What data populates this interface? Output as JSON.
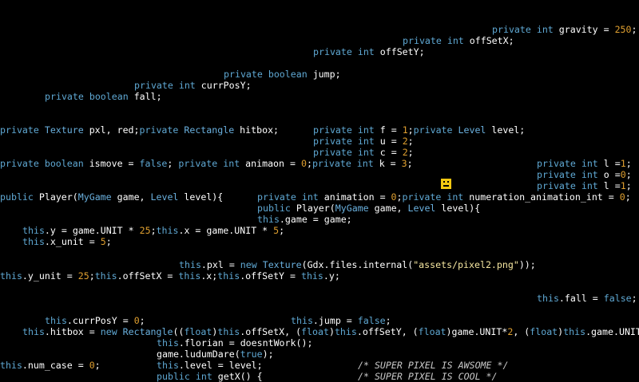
{
  "theme": {
    "background": "#000000",
    "default_text": "#ffffff",
    "keyword": "#5fa8d3",
    "number": "#e0a030",
    "string": "#f5e6a0",
    "comment": "#c8c8c8"
  },
  "lines": [
    {
      "tokens": [
        {
          "t": "private int ",
          "c": "kw"
        },
        {
          "t": "gravity = ",
          "c": "w"
        },
        {
          "t": "250",
          "c": "num"
        },
        {
          "t": ";",
          "c": "w"
        }
      ]
    },
    {
      "tokens": [
        {
          "t": "private int ",
          "c": "kw"
        },
        {
          "t": "offSetX;",
          "c": "w"
        }
      ]
    },
    {
      "tokens": [
        {
          "t": "private int ",
          "c": "kw"
        },
        {
          "t": "offSetY;",
          "c": "w"
        }
      ]
    },
    {
      "tokens": [
        {
          "t": "private boolean ",
          "c": "kw"
        },
        {
          "t": "jump;",
          "c": "w"
        }
      ]
    },
    {
      "tokens": [
        {
          "t": "private int ",
          "c": "kw"
        },
        {
          "t": "currPosY;",
          "c": "w"
        }
      ]
    },
    {
      "tokens": [
        {
          "t": "private boolean ",
          "c": "kw"
        },
        {
          "t": "fall;",
          "c": "w"
        }
      ]
    },
    {
      "tokens": [
        {
          "t": "private ",
          "c": "kw"
        },
        {
          "t": "Texture ",
          "c": "ty"
        },
        {
          "t": "pxl, red;",
          "c": "w"
        },
        {
          "t": "private ",
          "c": "kw"
        },
        {
          "t": "Rectangle ",
          "c": "ty"
        },
        {
          "t": "hitbox;",
          "c": "w"
        }
      ]
    },
    {
      "tokens": [
        {
          "t": "private int ",
          "c": "kw"
        },
        {
          "t": "f = ",
          "c": "w"
        },
        {
          "t": "1",
          "c": "num"
        },
        {
          "t": ";",
          "c": "w"
        },
        {
          "t": "private ",
          "c": "kw"
        },
        {
          "t": "Level ",
          "c": "ty"
        },
        {
          "t": "level;",
          "c": "w"
        }
      ]
    },
    {
      "tokens": [
        {
          "t": "private int ",
          "c": "kw"
        },
        {
          "t": "u = ",
          "c": "w"
        },
        {
          "t": "2",
          "c": "num"
        },
        {
          "t": ";",
          "c": "w"
        }
      ]
    },
    {
      "tokens": [
        {
          "t": "private int ",
          "c": "kw"
        },
        {
          "t": "c = ",
          "c": "w"
        },
        {
          "t": "2",
          "c": "num"
        },
        {
          "t": ";",
          "c": "w"
        }
      ]
    },
    {
      "tokens": [
        {
          "t": "private boolean ",
          "c": "kw"
        },
        {
          "t": "ismove = ",
          "c": "w"
        },
        {
          "t": "false",
          "c": "kw"
        },
        {
          "t": "; ",
          "c": "w"
        },
        {
          "t": "private int ",
          "c": "kw"
        },
        {
          "t": "animaon = ",
          "c": "w"
        },
        {
          "t": "0",
          "c": "num"
        },
        {
          "t": ";",
          "c": "w"
        },
        {
          "t": "private int ",
          "c": "kw"
        },
        {
          "t": "k = ",
          "c": "w"
        },
        {
          "t": "3",
          "c": "num"
        },
        {
          "t": ";",
          "c": "w"
        }
      ]
    },
    {
      "tokens": [
        {
          "t": "private int ",
          "c": "kw"
        },
        {
          "t": "l =",
          "c": "w"
        },
        {
          "t": "1",
          "c": "num"
        },
        {
          "t": ";",
          "c": "w"
        }
      ]
    },
    {
      "tokens": [
        {
          "t": "private int ",
          "c": "kw"
        },
        {
          "t": "o =",
          "c": "w"
        },
        {
          "t": "0",
          "c": "num"
        },
        {
          "t": ";",
          "c": "w"
        }
      ]
    },
    {
      "tokens": [
        {
          "t": "private int ",
          "c": "kw"
        },
        {
          "t": "l =",
          "c": "w"
        },
        {
          "t": "1",
          "c": "num"
        },
        {
          "t": ";",
          "c": "w"
        }
      ]
    },
    {
      "tokens": [
        {
          "t": "public ",
          "c": "kw"
        },
        {
          "t": "Player(",
          "c": "w"
        },
        {
          "t": "MyGame ",
          "c": "ty"
        },
        {
          "t": "game, ",
          "c": "w"
        },
        {
          "t": "Level ",
          "c": "ty"
        },
        {
          "t": "level){",
          "c": "w"
        }
      ]
    },
    {
      "tokens": [
        {
          "t": "private int ",
          "c": "kw"
        },
        {
          "t": "animation = ",
          "c": "w"
        },
        {
          "t": "0",
          "c": "num"
        },
        {
          "t": ";",
          "c": "w"
        },
        {
          "t": "private int ",
          "c": "kw"
        },
        {
          "t": "numeration_animation_int = ",
          "c": "w"
        },
        {
          "t": "0",
          "c": "num"
        },
        {
          "t": ";",
          "c": "w"
        }
      ]
    },
    {
      "tokens": [
        {
          "t": "public ",
          "c": "kw"
        },
        {
          "t": "Player(",
          "c": "w"
        },
        {
          "t": "MyGame ",
          "c": "ty"
        },
        {
          "t": "game, ",
          "c": "w"
        },
        {
          "t": "Level ",
          "c": "ty"
        },
        {
          "t": "level){",
          "c": "w"
        }
      ]
    },
    {
      "tokens": [
        {
          "t": "this",
          "c": "kw"
        },
        {
          "t": ".game = game;",
          "c": "w"
        }
      ]
    },
    {
      "tokens": [
        {
          "t": "this",
          "c": "kw"
        },
        {
          "t": ".y = game.UNIT * ",
          "c": "w"
        },
        {
          "t": "25",
          "c": "num"
        },
        {
          "t": ";",
          "c": "w"
        },
        {
          "t": "this",
          "c": "kw"
        },
        {
          "t": ".x = game.UNIT * ",
          "c": "w"
        },
        {
          "t": "5",
          "c": "num"
        },
        {
          "t": ";",
          "c": "w"
        }
      ]
    },
    {
      "tokens": [
        {
          "t": "this",
          "c": "kw"
        },
        {
          "t": ".x_unit = ",
          "c": "w"
        },
        {
          "t": "5",
          "c": "num"
        },
        {
          "t": ";",
          "c": "w"
        }
      ]
    },
    {
      "tokens": [
        {
          "t": "this",
          "c": "kw"
        },
        {
          "t": ".pxl = ",
          "c": "w"
        },
        {
          "t": "new ",
          "c": "kw"
        },
        {
          "t": "Texture",
          "c": "ty"
        },
        {
          "t": "(Gdx.files.internal(",
          "c": "w"
        },
        {
          "t": "\"assets/pixel2.png\"",
          "c": "str"
        },
        {
          "t": "));",
          "c": "w"
        }
      ]
    },
    {
      "tokens": [
        {
          "t": "this",
          "c": "kw"
        },
        {
          "t": ".y_unit = ",
          "c": "w"
        },
        {
          "t": "25",
          "c": "num"
        },
        {
          "t": ";",
          "c": "w"
        },
        {
          "t": "this",
          "c": "kw"
        },
        {
          "t": ".offSetX = ",
          "c": "w"
        },
        {
          "t": "this",
          "c": "kw"
        },
        {
          "t": ".x;",
          "c": "w"
        },
        {
          "t": "this",
          "c": "kw"
        },
        {
          "t": ".offSetY = ",
          "c": "w"
        },
        {
          "t": "this",
          "c": "kw"
        },
        {
          "t": ".y;",
          "c": "w"
        }
      ]
    },
    {
      "tokens": [
        {
          "t": "this",
          "c": "kw"
        },
        {
          "t": ".fall = ",
          "c": "w"
        },
        {
          "t": "false",
          "c": "kw"
        },
        {
          "t": ";",
          "c": "w"
        }
      ]
    },
    {
      "tokens": [
        {
          "t": "this",
          "c": "kw"
        },
        {
          "t": ".currPosY = ",
          "c": "w"
        },
        {
          "t": "0",
          "c": "num"
        },
        {
          "t": ";",
          "c": "w"
        }
      ]
    },
    {
      "tokens": [
        {
          "t": "this",
          "c": "kw"
        },
        {
          "t": ".jump = ",
          "c": "w"
        },
        {
          "t": "false",
          "c": "kw"
        },
        {
          "t": ";",
          "c": "w"
        }
      ]
    },
    {
      "tokens": [
        {
          "t": "this",
          "c": "kw"
        },
        {
          "t": ".hitbox = ",
          "c": "w"
        },
        {
          "t": "new ",
          "c": "kw"
        },
        {
          "t": "Rectangle",
          "c": "ty"
        },
        {
          "t": "((",
          "c": "w"
        },
        {
          "t": "float",
          "c": "kw"
        },
        {
          "t": ")",
          "c": "w"
        },
        {
          "t": "this",
          "c": "kw"
        },
        {
          "t": ".offSetX, (",
          "c": "w"
        },
        {
          "t": "float",
          "c": "kw"
        },
        {
          "t": ")",
          "c": "w"
        },
        {
          "t": "this",
          "c": "kw"
        },
        {
          "t": ".offSetY, (",
          "c": "w"
        },
        {
          "t": "float",
          "c": "kw"
        },
        {
          "t": ")game.UNIT*",
          "c": "w"
        },
        {
          "t": "2",
          "c": "num"
        },
        {
          "t": ", (",
          "c": "w"
        },
        {
          "t": "float",
          "c": "kw"
        },
        {
          "t": ")",
          "c": "w"
        },
        {
          "t": "this",
          "c": "kw"
        },
        {
          "t": ".game.UNIT",
          "c": "w"
        }
      ]
    },
    {
      "tokens": [
        {
          "t": "this",
          "c": "kw"
        },
        {
          "t": ".florian = doesntWork();",
          "c": "w"
        }
      ]
    },
    {
      "tokens": [
        {
          "t": "game.ludumDare(",
          "c": "w"
        },
        {
          "t": "true",
          "c": "kw"
        },
        {
          "t": ");",
          "c": "w"
        }
      ]
    },
    {
      "tokens": [
        {
          "t": "this",
          "c": "kw"
        },
        {
          "t": ".num_case = ",
          "c": "w"
        },
        {
          "t": "0",
          "c": "num"
        },
        {
          "t": ";",
          "c": "w"
        }
      ]
    },
    {
      "tokens": [
        {
          "t": "this",
          "c": "kw"
        },
        {
          "t": ".level = level;",
          "c": "w"
        }
      ]
    },
    {
      "tokens": [
        {
          "t": "/* SUPER PIXEL IS AWSOME */",
          "c": "cm"
        }
      ]
    },
    {
      "tokens": [
        {
          "t": "public int ",
          "c": "kw"
        },
        {
          "t": "getX() {",
          "c": "w"
        }
      ]
    },
    {
      "tokens": [
        {
          "t": "/* SUPER PIXEL IS COOL */",
          "c": "cm"
        }
      ]
    }
  ]
}
